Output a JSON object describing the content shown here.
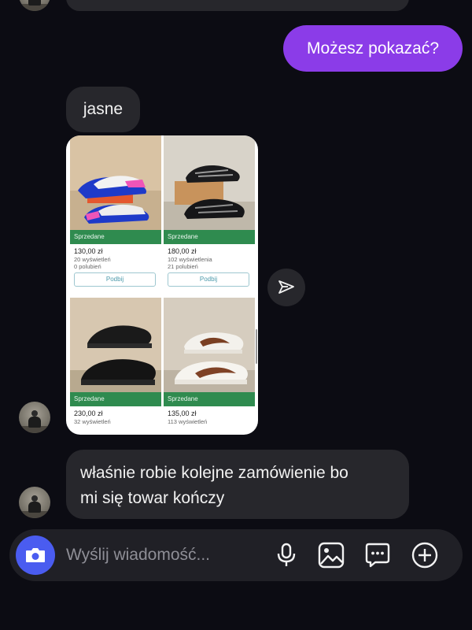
{
  "messages": {
    "outgoing_1": "Możesz pokazać?",
    "incoming_1": "jasne",
    "incoming_2_line1": "właśnie robie kolejne zamówienie bo",
    "incoming_2_line2": "mi się towar kończy"
  },
  "shared_post": {
    "listings": [
      {
        "badge": "Sprzedane",
        "price": "130,00 zł",
        "views": "20 wyświetleń",
        "likes": "0 polubień",
        "bump": "Podbij"
      },
      {
        "badge": "Sprzedane",
        "price": "180,00 zł",
        "views": "102 wyświetlenia",
        "likes": "21 polubień",
        "bump": "Podbij"
      },
      {
        "badge": "Sprzedane",
        "price": "230,00 zł",
        "views": "32 wyświetleń"
      },
      {
        "badge": "Sprzedane",
        "price": "135,00 zł",
        "views": "113 wyświetleń"
      }
    ]
  },
  "composer": {
    "placeholder": "Wyślij wiadomość..."
  },
  "icons": {
    "camera": "camera-icon",
    "microphone": "microphone-icon",
    "gallery": "gallery-icon",
    "sticker": "chat-sticker-icon",
    "add": "add-circle-icon",
    "share": "share-send-icon"
  },
  "colors": {
    "background": "#0c0c13",
    "incoming_bubble": "#27272c",
    "outgoing_bubble": "#8b3ce8",
    "sold_badge": "#2f8b4f",
    "camera_button": "#4a5cf0"
  }
}
